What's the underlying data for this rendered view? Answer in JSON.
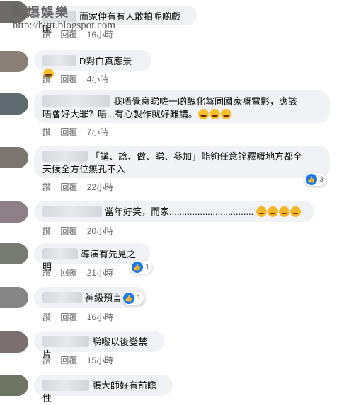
{
  "watermark": {
    "title": "熱爆娛樂",
    "url": "http://hittt.blogspot.com"
  },
  "action_like": "讚",
  "action_reply": "回覆",
  "comments": [
    {
      "text": "而家仲有有人敢拍呢啲戲呢",
      "time": "16小時"
    },
    {
      "text": "D對白真應景",
      "time": "4小時"
    },
    {
      "text_line1": "我唔覺意睇咗一啲醜化黨同國家嘅電影，應該",
      "text_line2": "唔會好大罪？唔...有心製作就好難講。",
      "time": "7小時"
    },
    {
      "text_line1": "「講、諗、做、睇、參加」能夠任意詮釋嘅地方都全",
      "text_line2": "天候全方位無孔不入",
      "time": "22小時",
      "reactions": "3"
    },
    {
      "text": "當年好笑，而家.................................",
      "time": "20小時"
    },
    {
      "text": "導演有先見之明",
      "time": "21小時",
      "reactions": "1"
    },
    {
      "text": "神級預言",
      "time": "16小時",
      "reactions": "1"
    },
    {
      "text": "睇嚟以後變禁片",
      "time": "15小時"
    },
    {
      "text": "張大師好有前瞻性"
    }
  ],
  "colors": {
    "bubble": "#f0f2f5",
    "like_blue": "#1877f2",
    "meta_gray": "#65676b"
  }
}
